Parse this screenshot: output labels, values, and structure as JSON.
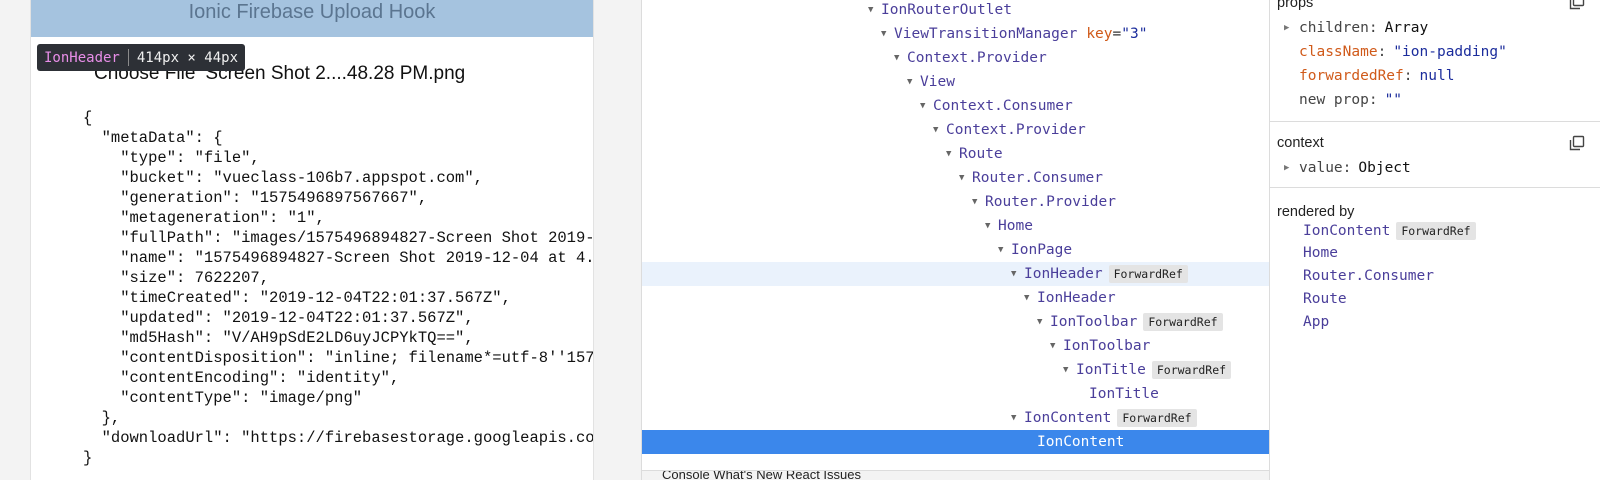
{
  "preview": {
    "header_title": "Ionic Firebase Upload Hook",
    "tooltip": {
      "component": "IonHeader",
      "size": "414px × 44px"
    },
    "file_input": {
      "button_label": "Choose File",
      "file_name": "Screen Shot 2....48.28 PM.png"
    },
    "json_output": "{\n  \"metaData\": {\n    \"type\": \"file\",\n    \"bucket\": \"vueclass-106b7.appspot.com\",\n    \"generation\": \"1575496897567667\",\n    \"metageneration\": \"1\",\n    \"fullPath\": \"images/1575496894827-Screen Shot 2019-12-04 at 4.48.28 PM.png\",\n    \"name\": \"1575496894827-Screen Shot 2019-12-04 at 4.48.28 PM.png\",\n    \"size\": 7622207,\n    \"timeCreated\": \"2019-12-04T22:01:37.567Z\",\n    \"updated\": \"2019-12-04T22:01:37.567Z\",\n    \"md5Hash\": \"V/AH9pSdE2LD6uyJCPYkTQ==\",\n    \"contentDisposition\": \"inline; filename*=utf-8''1575496894827-Screen%20Shot\",\n    \"contentEncoding\": \"identity\",\n    \"contentType\": \"image/png\"\n  },\n  \"downloadUrl\": \"https://firebasestorage.googleapis.com/v0/b/vueclass-106b7.appspot.com\"\n}"
  },
  "tree": {
    "rows": [
      {
        "name": "IonRouterOutlet",
        "depth": 0,
        "expanded": true
      },
      {
        "name": "ViewTransitionManager",
        "depth": 1,
        "expanded": true,
        "attr_key": "key",
        "attr_val": "\"3\""
      },
      {
        "name": "Context.Provider",
        "depth": 2,
        "expanded": true
      },
      {
        "name": "View",
        "depth": 3,
        "expanded": true
      },
      {
        "name": "Context.Consumer",
        "depth": 4,
        "expanded": true
      },
      {
        "name": "Context.Provider",
        "depth": 5,
        "expanded": true
      },
      {
        "name": "Route",
        "depth": 6,
        "expanded": true
      },
      {
        "name": "Router.Consumer",
        "depth": 7,
        "expanded": true
      },
      {
        "name": "Router.Provider",
        "depth": 8,
        "expanded": true
      },
      {
        "name": "Home",
        "depth": 9,
        "expanded": true
      },
      {
        "name": "IonPage",
        "depth": 10,
        "expanded": true
      },
      {
        "name": "IonHeader",
        "depth": 11,
        "expanded": true,
        "badge": "ForwardRef",
        "state": "hover"
      },
      {
        "name": "IonHeader",
        "depth": 12,
        "expanded": true
      },
      {
        "name": "IonToolbar",
        "depth": 13,
        "expanded": true,
        "badge": "ForwardRef"
      },
      {
        "name": "IonToolbar",
        "depth": 14,
        "expanded": true
      },
      {
        "name": "IonTitle",
        "depth": 15,
        "expanded": true,
        "badge": "ForwardRef"
      },
      {
        "name": "IonTitle",
        "depth": 16,
        "expanded": false
      },
      {
        "name": "IonContent",
        "depth": 11,
        "expanded": true,
        "badge": "ForwardRef"
      },
      {
        "name": "IonContent",
        "depth": 12,
        "expanded": false,
        "state": "selected"
      }
    ],
    "status_text": "Console   What's New   React   Issues"
  },
  "inspector": {
    "props_title": "props",
    "props": [
      {
        "key": "children",
        "value": "Array",
        "expandable": true,
        "key_color": "gray",
        "val_style": "dark"
      },
      {
        "key": "className",
        "value": "\"ion-padding\"",
        "expandable": false,
        "key_color": "orange",
        "val_style": "blue"
      },
      {
        "key": "forwardedRef",
        "value": "null",
        "expandable": false,
        "key_color": "orange",
        "val_style": "blue"
      },
      {
        "key": "new prop",
        "value": "\"\"",
        "expandable": false,
        "key_color": "gray",
        "val_style": "blue"
      }
    ],
    "context_title": "context",
    "context": [
      {
        "key": "value",
        "value": "Object",
        "expandable": true
      }
    ],
    "rendered_by_title": "rendered by",
    "rendered_by": [
      {
        "name": "IonContent",
        "badge": "ForwardRef"
      },
      {
        "name": "Home"
      },
      {
        "name": "Router.Consumer"
      },
      {
        "name": "Route"
      },
      {
        "name": "App"
      }
    ]
  }
}
